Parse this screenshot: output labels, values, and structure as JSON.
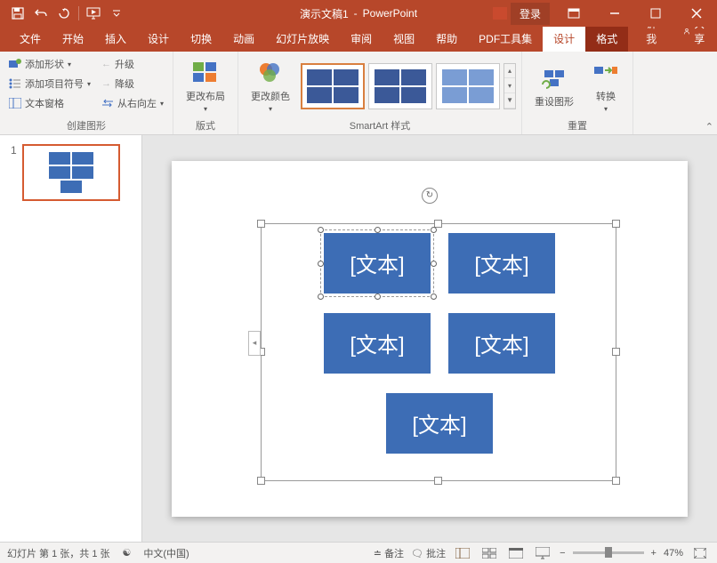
{
  "titlebar": {
    "doc_name": "演示文稿1",
    "app_name": "PowerPoint",
    "login": "登录"
  },
  "tabs": {
    "file": "文件",
    "home": "开始",
    "insert": "插入",
    "design": "设计",
    "transitions": "切换",
    "animations": "动画",
    "slideshow": "幻灯片放映",
    "review": "审阅",
    "view": "视图",
    "help": "帮助",
    "pdf": "PDF工具集",
    "smartart_design": "设计",
    "format": "格式",
    "tell_me": "告诉我",
    "share": "共享"
  },
  "ribbon": {
    "create_shape": {
      "add_shape": "添加形状",
      "add_bullet": "添加项目符号",
      "text_pane": "文本窗格",
      "promote": "升级",
      "demote": "降级",
      "rtl": "从右向左",
      "label": "创建图形"
    },
    "layouts": {
      "change_layout": "更改布局",
      "label": "版式"
    },
    "styles": {
      "change_colors": "更改颜色",
      "label": "SmartArt 样式"
    },
    "reset": {
      "reset_graphic": "重设图形",
      "convert": "转换",
      "label": "重置"
    }
  },
  "slide": {
    "number": "1",
    "placeholder": "[文本]"
  },
  "statusbar": {
    "slide_info": "幻灯片 第 1 张，共 1 张",
    "language": "中文(中国)",
    "notes": "备注",
    "comments": "批注",
    "zoom": "47%"
  }
}
